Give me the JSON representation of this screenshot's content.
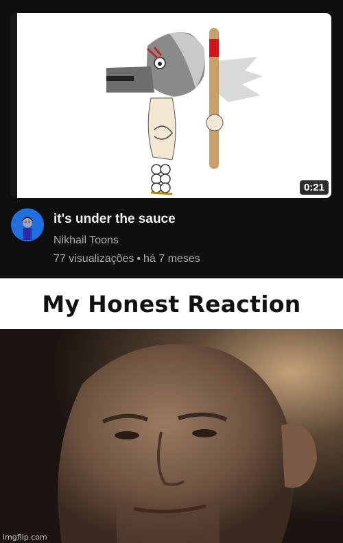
{
  "video": {
    "duration": "0:21",
    "title": "it's under the sauce",
    "channel": "Nikhail Toons",
    "views": "77 visualizações",
    "separator": "•",
    "age": "há 7 meses"
  },
  "meme": {
    "caption": "My Honest Reaction",
    "watermark": "imgflip.com"
  },
  "colors": {
    "background": "#0f0f0f",
    "title_text": "#f1f1f1",
    "secondary_text": "#aaaaaa",
    "avatar_bg": "#1f6fe0"
  }
}
